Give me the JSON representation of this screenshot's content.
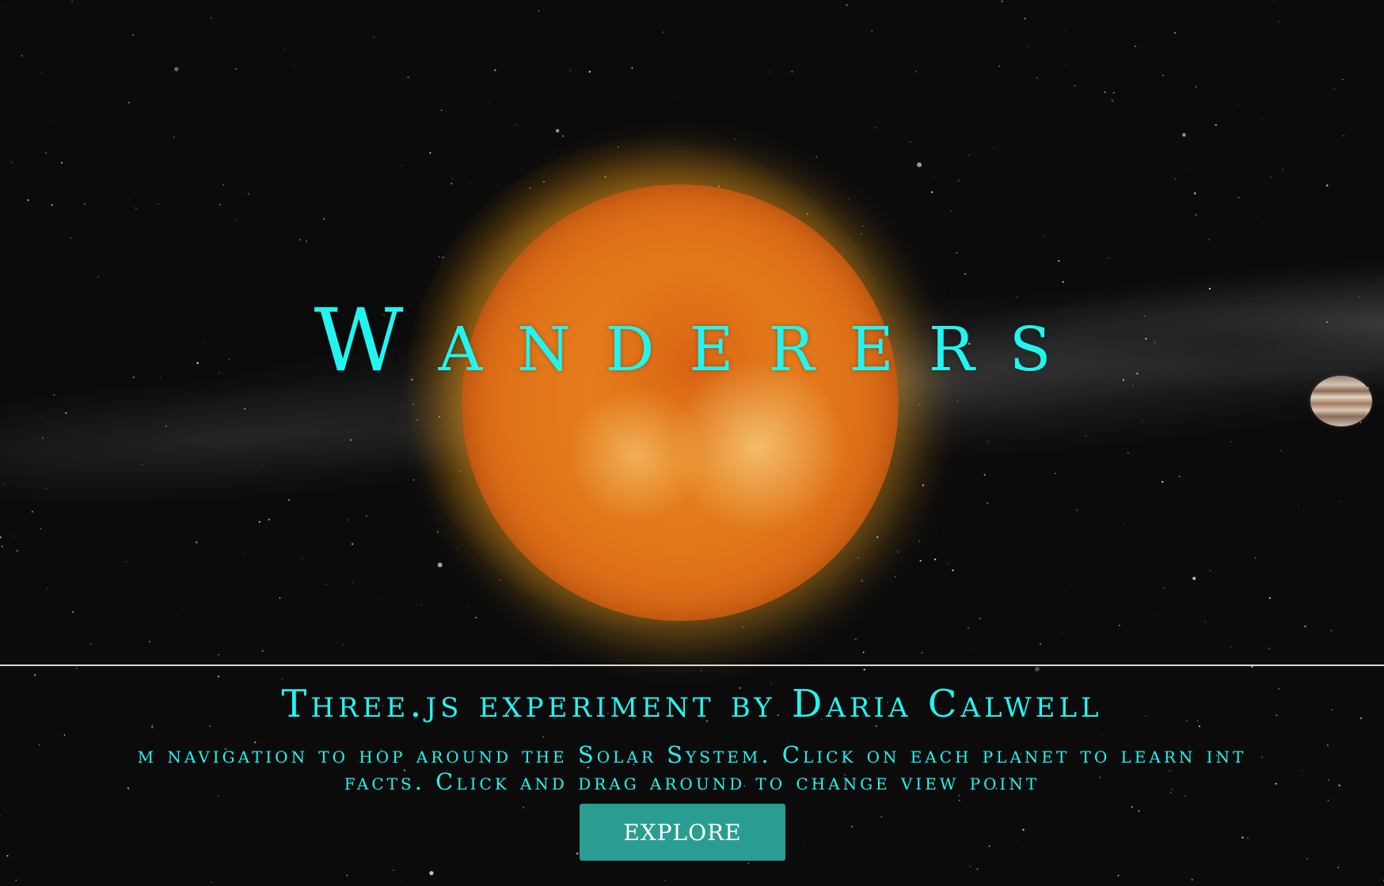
{
  "hero": {
    "title": "Wanderers"
  },
  "footer": {
    "subtitle": "Three.js experiment by Daria Calwell",
    "description_line_1": "m navigation to hop around the Solar System. Click on each planet to learn int",
    "description_line_2": "facts. Click and drag around to change view point",
    "explore_label": "EXPLORE"
  },
  "colors": {
    "text_accent": "#22f5f0",
    "button_bg": "#2a9d93",
    "background": "#0b0b0c",
    "sun": "#e2771a"
  },
  "scene": {
    "objects": [
      "sun",
      "jupiter",
      "milky-way",
      "stars"
    ]
  }
}
